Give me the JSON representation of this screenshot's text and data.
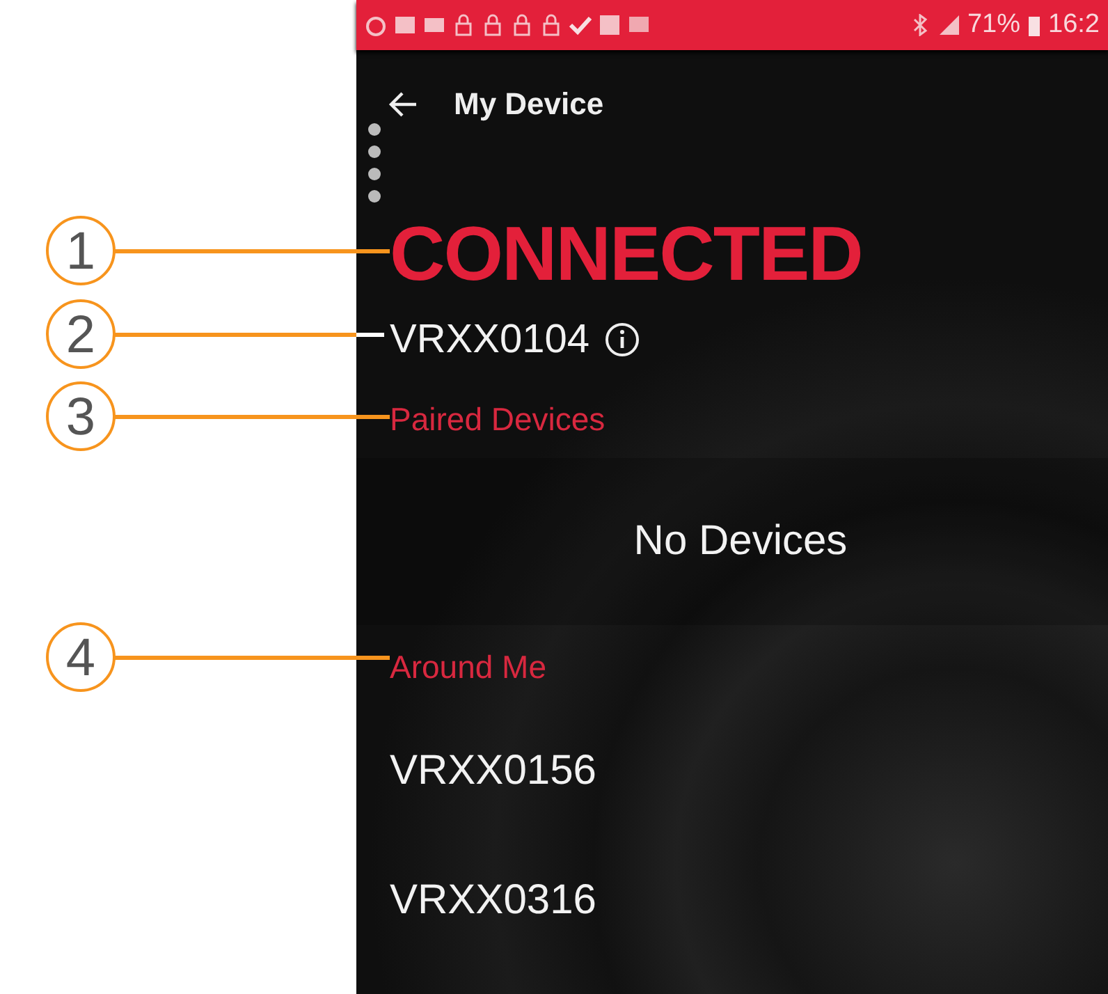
{
  "status_bar": {
    "battery": "71%",
    "time": "16:2"
  },
  "header": {
    "title": "My Device"
  },
  "connection": {
    "status": "CONNECTED",
    "device": "VRXX0104"
  },
  "paired": {
    "title": "Paired Devices",
    "empty_text": "No Devices"
  },
  "around": {
    "title": "Around Me",
    "devices": [
      "VRXX0156",
      "VRXX0316"
    ]
  },
  "callouts": [
    "1",
    "2",
    "3",
    "4"
  ]
}
